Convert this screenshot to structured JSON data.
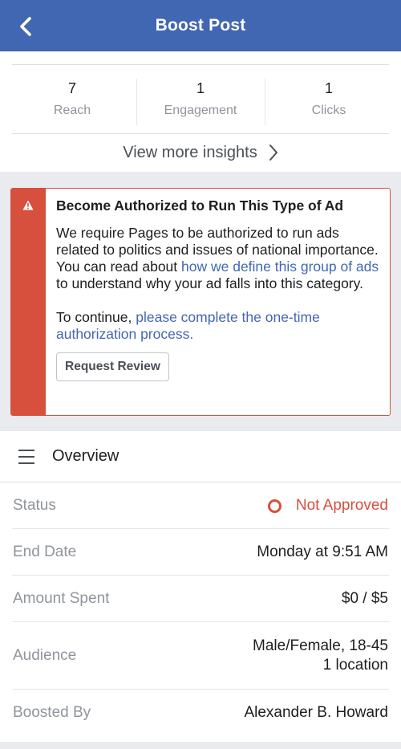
{
  "header": {
    "title": "Boost Post"
  },
  "stats": [
    {
      "value": "7",
      "label": "Reach"
    },
    {
      "value": "1",
      "label": "Engagement"
    },
    {
      "value": "1",
      "label": "Clicks"
    }
  ],
  "insights_link": "View more insights",
  "alert": {
    "title": "Become Authorized to Run This Type of Ad",
    "p1_text_a": "We require Pages to be authorized to run ads related to politics and issues of national importance. You can read about ",
    "p1_link": "how we define this group of ads",
    "p1_text_b": " to understand why your ad falls into this category.",
    "p2_text_a": "To continue, ",
    "p2_link": "please complete the one-time authorization process.",
    "button": "Request Review",
    "accent_color": "#d6503d"
  },
  "overview": {
    "title": "Overview",
    "rows": [
      {
        "label": "Status",
        "value": "Not Approved"
      },
      {
        "label": "End Date",
        "value": "Monday at 9:51 AM"
      },
      {
        "label": "Amount Spent",
        "value": "$0 / $5"
      },
      {
        "label": "Audience",
        "value_line1": "Male/Female, 18-45",
        "value_line2": "1 location"
      },
      {
        "label": "Boosted By",
        "value": "Alexander B. Howard"
      }
    ]
  },
  "icons": {
    "back": "chevron-left-icon",
    "insights": "chevron-right-icon",
    "alert": "warning-icon",
    "overview": "menu-icon",
    "status": "ring-icon"
  },
  "colors": {
    "brand": "#4267b2",
    "error": "#d6503d"
  }
}
